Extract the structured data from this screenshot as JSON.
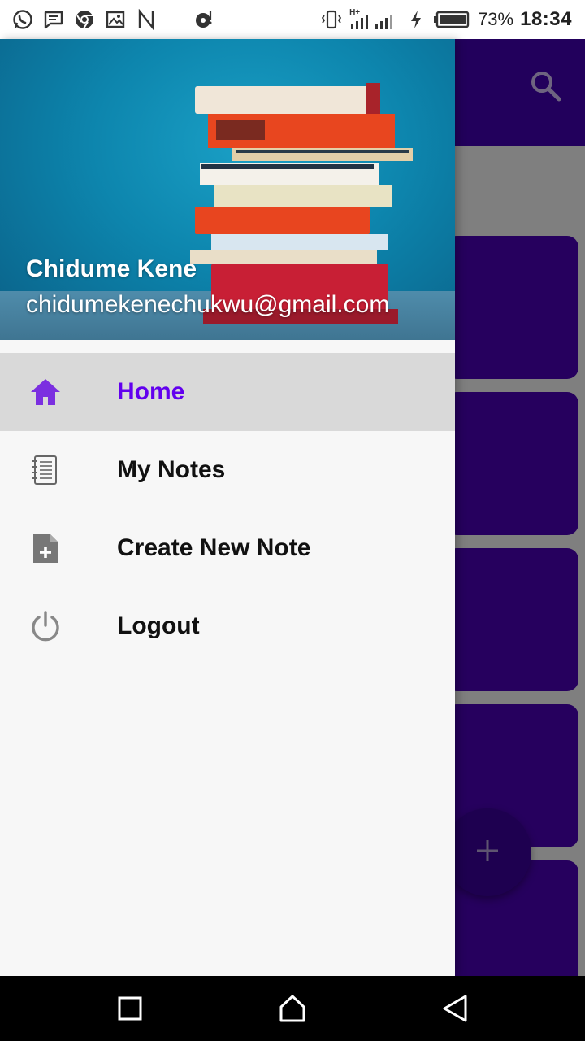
{
  "status_bar": {
    "battery_percent": "73%",
    "time": "18:34",
    "network_label": "H+",
    "left_icons": [
      "whatsapp-icon",
      "message-icon",
      "chrome-icon",
      "gallery-icon",
      "n-icon",
      "music-icon"
    ],
    "right_icons": [
      "vibrate-icon",
      "signal-icon",
      "charging-icon",
      "battery-icon"
    ]
  },
  "drawer": {
    "header": {
      "name": "Chidume Kene",
      "email": "chidumekenechukwu@gmail.com"
    },
    "items": [
      {
        "label": "Home",
        "icon": "home-icon",
        "active": true
      },
      {
        "label": "My Notes",
        "icon": "notebook-icon",
        "active": false
      },
      {
        "label": "Create New Note",
        "icon": "note-add-icon",
        "active": false
      },
      {
        "label": "Logout",
        "icon": "power-icon",
        "active": false
      }
    ]
  },
  "colors": {
    "primary": "#22005c",
    "accent_active": "#6200ee",
    "card": "#26005e"
  },
  "nav_bar": {
    "buttons": [
      "recents-icon",
      "home-nav-icon",
      "back-icon"
    ]
  }
}
